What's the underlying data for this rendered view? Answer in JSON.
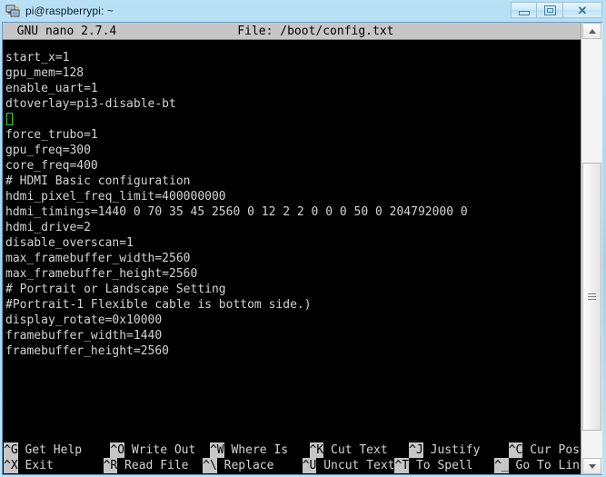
{
  "window": {
    "title": "pi@raspberrypi: ~",
    "icon": "putty-icon",
    "buttons": {
      "minimize": "minimize-button",
      "maximize": "maximize-button",
      "close": "✕"
    }
  },
  "nano": {
    "version_label": "  GNU nano 2.7.4",
    "file_label": "File: /boot/config.txt",
    "header_line": "  GNU nano 2.7.4                 File: /boot/config.txt",
    "lines": [
      "start_x=1",
      "gpu_mem=128",
      "enable_uart=1",
      "dtoverlay=pi3-disable-bt",
      "",
      "force_trubo=1",
      "gpu_freq=300",
      "core_freq=400",
      "# HDMI Basic configuration",
      "hdmi_pixel_freq_limit=400000000",
      "hdmi_timings=1440 0 70 35 45 2560 0 12 2 2 0 0 0 50 0 204792000 0",
      "hdmi_drive=2",
      "disable_overscan=1",
      "max_framebuffer_width=2560",
      "max_framebuffer_height=2560",
      "# Portrait or Landscape Setting",
      "#Portrait-1 Flexible cable is bottom side.)",
      "display_rotate=0x10000",
      "framebuffer_width=1440",
      "framebuffer_height=2560"
    ],
    "cursor_line_index": 4,
    "shortcuts_row1": [
      {
        "key": "^G",
        "label": " Get Help    "
      },
      {
        "key": "^O",
        "label": " Write Out  "
      },
      {
        "key": "^W",
        "label": " Where Is   "
      },
      {
        "key": "^K",
        "label": " Cut Text   "
      },
      {
        "key": "^J",
        "label": " Justify    "
      },
      {
        "key": "^C",
        "label": " Cur Pos"
      }
    ],
    "shortcuts_row2": [
      {
        "key": "^X",
        "label": " Exit       "
      },
      {
        "key": "^R",
        "label": " Read File  "
      },
      {
        "key": "^\\",
        "label": " Replace    "
      },
      {
        "key": "^U",
        "label": " Uncut Text"
      },
      {
        "key": "^T",
        "label": " To Spell   "
      },
      {
        "key": "^_",
        "label": " Go To Line"
      }
    ]
  },
  "colors": {
    "terminal_bg": "#000000",
    "terminal_fg": "#d4d4d4",
    "reverse_bg": "#c6c6c6",
    "cursor": "#2fd52f",
    "titlebar": "#a8d8f2"
  }
}
